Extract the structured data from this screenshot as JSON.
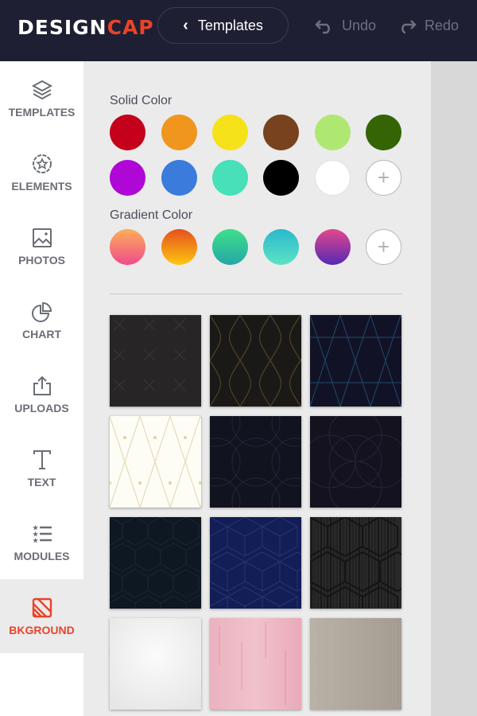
{
  "header": {
    "logo_main": "DESIGN",
    "logo_accent": "CAP",
    "back_button": "Templates",
    "undo": "Undo",
    "redo": "Redo"
  },
  "sidebar": {
    "items": [
      {
        "label": "TEMPLATES",
        "icon": "layers-icon"
      },
      {
        "label": "ELEMENTS",
        "icon": "badge-star-icon"
      },
      {
        "label": "PHOTOS",
        "icon": "image-icon"
      },
      {
        "label": "CHART",
        "icon": "pie-chart-icon"
      },
      {
        "label": "UPLOADS",
        "icon": "upload-icon"
      },
      {
        "label": "TEXT",
        "icon": "text-icon"
      },
      {
        "label": "MODULES",
        "icon": "star-list-icon"
      },
      {
        "label": "BKGROUND",
        "icon": "background-icon",
        "active": true
      }
    ]
  },
  "panel": {
    "solid_title": "Solid Color",
    "gradient_title": "Gradient Color",
    "solid_colors": [
      "#c4001a",
      "#f0961f",
      "#f5e218",
      "#77421d",
      "#aee872",
      "#346404",
      "#ae07d6",
      "#3a7bdc",
      "#47e0b8",
      "#000000",
      "#ffffff"
    ],
    "gradient_colors": [
      [
        "#fdae5a",
        "#f04c8c"
      ],
      [
        "#e6501f",
        "#fcc70f"
      ],
      [
        "#3ee089",
        "#26a6a8"
      ],
      [
        "#2bb8cc",
        "#5de3c3"
      ],
      [
        "#e3488c",
        "#5428b6"
      ]
    ],
    "add_label": "+",
    "backgrounds": [
      "dark-cross-pattern",
      "dark-gold-wave-pattern",
      "navy-triangle-pattern",
      "cream-diamond-pattern",
      "navy-flower-pattern",
      "navy-circle-pattern",
      "dark-hexagon-pattern",
      "blue-cube-pattern",
      "black-striped-cube-pattern",
      "white-paper-texture",
      "pink-paint-texture",
      "beige-linen-texture"
    ]
  },
  "accent_color": "#e9432a"
}
